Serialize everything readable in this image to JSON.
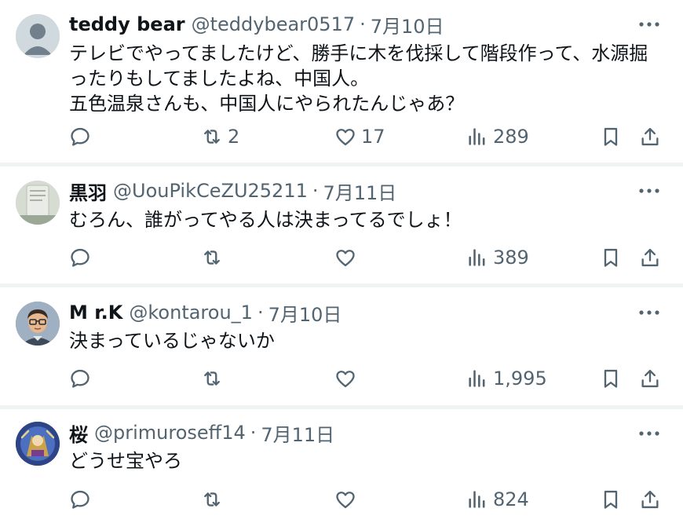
{
  "tweets": [
    {
      "name": "teddy bear",
      "handle": "@teddybear0517",
      "date": "7月10日",
      "text": "テレビでやってましたけど、勝手に木を伐採して階段作って、水源掘\nったりもしてましたよね、中国人。\n五色温泉さんも、中国人にやられたんじゃあ？",
      "replies": "",
      "retweets": "2",
      "likes": "17",
      "views": "289",
      "avatar": "default-avatar-icon"
    },
    {
      "name": "黒羽",
      "handle": "@UouPikCeZU25211",
      "date": "7月11日",
      "text": "むろん、誰がってやる人は決まってるでしょ！",
      "replies": "",
      "retweets": "",
      "likes": "",
      "views": "389",
      "avatar": "photo-avatar"
    },
    {
      "name": "M r.K",
      "handle": "@kontarou_1",
      "date": "7月10日",
      "text": "決まっているじゃないか",
      "replies": "",
      "retweets": "",
      "likes": "",
      "views": "1,995",
      "avatar": "illustrated-man-avatar"
    },
    {
      "name": "桜",
      "handle": "@primuroseff14",
      "date": "7月11日",
      "text": "どうせ宝やろ",
      "replies": "",
      "retweets": "",
      "likes": "",
      "views": "824",
      "avatar": "artwork-avatar"
    }
  ],
  "separator": "·",
  "colors": {
    "text": "#0f1419",
    "secondary": "#536471",
    "divider": "#eff3f4"
  }
}
